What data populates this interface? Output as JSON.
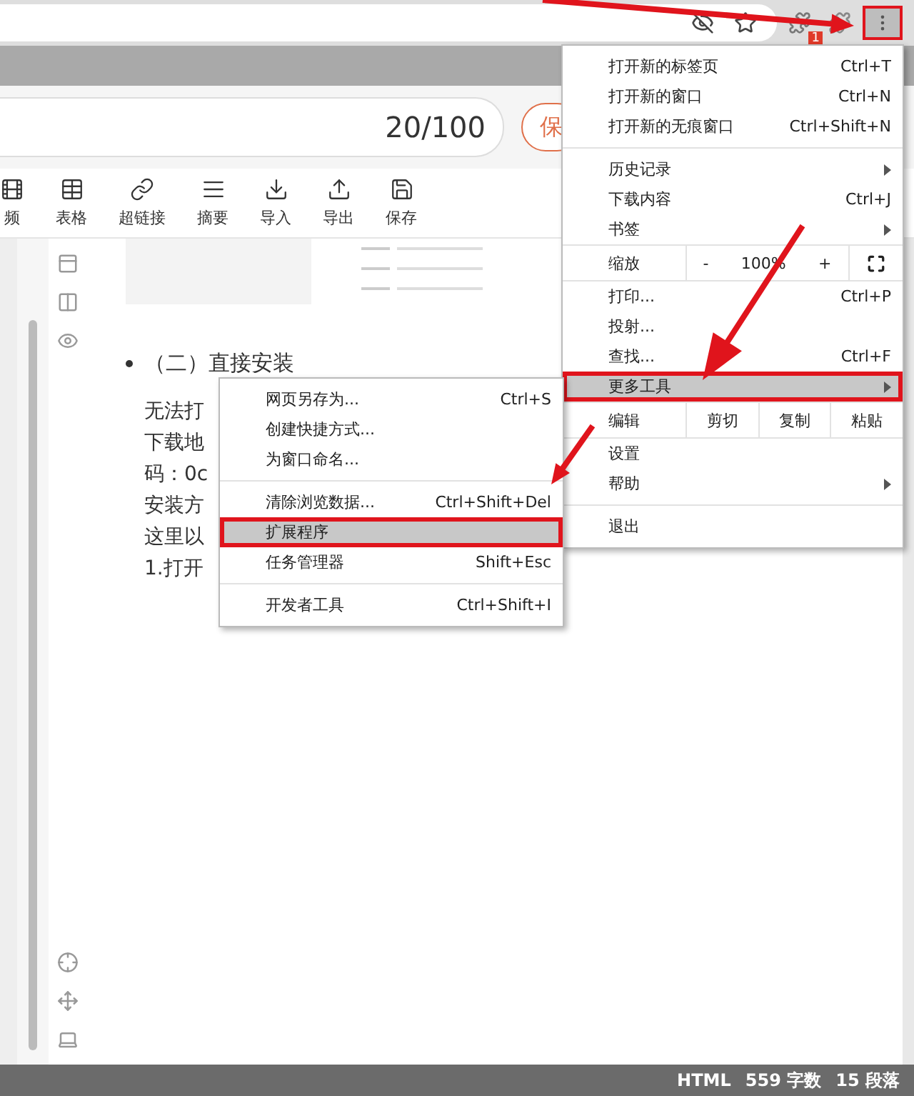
{
  "extension_badge": "1",
  "title_counter": "20/100",
  "save_button": "保",
  "toolbar": [
    {
      "label": "频",
      "kind": "video"
    },
    {
      "label": "表格",
      "kind": "table"
    },
    {
      "label": "超链接",
      "kind": "link"
    },
    {
      "label": "摘要",
      "kind": "summary"
    },
    {
      "label": "导入",
      "kind": "import"
    },
    {
      "label": "导出",
      "kind": "export"
    },
    {
      "label": "保存",
      "kind": "save"
    }
  ],
  "document": {
    "heading": "（二）直接安装",
    "lines": [
      "无法打",
      "下载地",
      "码：0c",
      "安装方",
      "这里以",
      "1.打开"
    ]
  },
  "main_menu": [
    {
      "kind": "item",
      "label": "打开新的标签页",
      "shortcut": "Ctrl+T",
      "submenu": false,
      "selected": false
    },
    {
      "kind": "item",
      "label": "打开新的窗口",
      "shortcut": "Ctrl+N",
      "submenu": false,
      "selected": false
    },
    {
      "kind": "item",
      "label": "打开新的无痕窗口",
      "shortcut": "Ctrl+Shift+N",
      "submenu": false,
      "selected": false
    },
    {
      "kind": "separator"
    },
    {
      "kind": "item",
      "label": "历史记录",
      "submenu": true,
      "selected": false
    },
    {
      "kind": "item",
      "label": "下载内容",
      "shortcut": "Ctrl+J",
      "submenu": false,
      "selected": false
    },
    {
      "kind": "item",
      "label": "书签",
      "submenu": true,
      "selected": false
    },
    {
      "kind": "zoom",
      "label": "缩放",
      "minus": "-",
      "value": "100%",
      "plus": "+"
    },
    {
      "kind": "item",
      "label": "打印...",
      "shortcut": "Ctrl+P",
      "submenu": false,
      "selected": false
    },
    {
      "kind": "item",
      "label": "投射...",
      "submenu": false,
      "selected": false
    },
    {
      "kind": "item",
      "label": "查找...",
      "shortcut": "Ctrl+F",
      "submenu": false,
      "selected": false
    },
    {
      "kind": "item",
      "label": "更多工具",
      "submenu": true,
      "selected": true
    },
    {
      "kind": "edit",
      "label": "编辑",
      "buttons": [
        "剪切",
        "复制",
        "粘贴"
      ]
    },
    {
      "kind": "item",
      "label": "设置",
      "submenu": false,
      "selected": false
    },
    {
      "kind": "item",
      "label": "帮助",
      "submenu": true,
      "selected": false
    },
    {
      "kind": "separator"
    },
    {
      "kind": "item",
      "label": "退出",
      "submenu": false,
      "selected": false
    }
  ],
  "sub_menu": [
    {
      "kind": "item",
      "label": "网页另存为...",
      "shortcut": "Ctrl+S",
      "selected": false
    },
    {
      "kind": "item",
      "label": "创建快捷方式...",
      "selected": false
    },
    {
      "kind": "item",
      "label": "为窗口命名...",
      "selected": false
    },
    {
      "kind": "separator"
    },
    {
      "kind": "item",
      "label": "清除浏览数据...",
      "shortcut": "Ctrl+Shift+Del",
      "selected": false
    },
    {
      "kind": "item",
      "label": "扩展程序",
      "selected": true
    },
    {
      "kind": "item",
      "label": "任务管理器",
      "shortcut": "Shift+Esc",
      "selected": false
    },
    {
      "kind": "separator"
    },
    {
      "kind": "item",
      "label": "开发者工具",
      "shortcut": "Ctrl+Shift+I",
      "selected": false
    }
  ],
  "status_bar": [
    "HTML",
    "559 字数",
    "15 段落"
  ]
}
